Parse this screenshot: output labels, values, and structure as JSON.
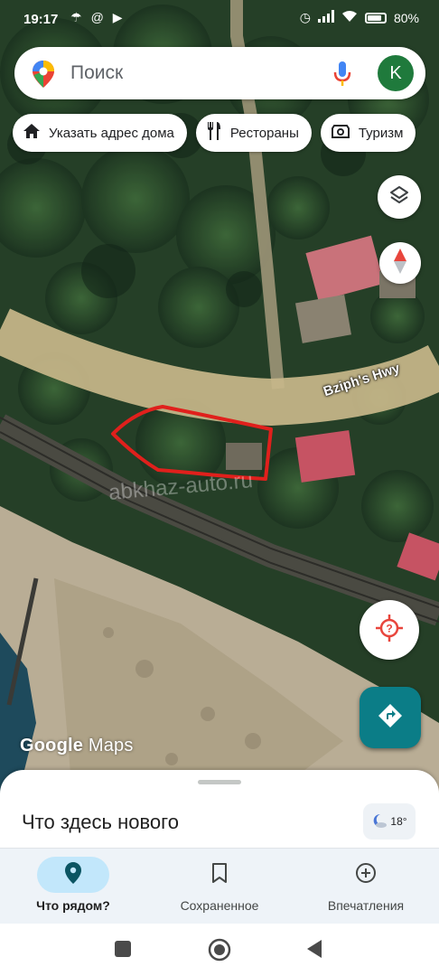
{
  "status_bar": {
    "time": "19:17",
    "battery": "80",
    "battery_level": 0.8,
    "icons": [
      "umbrella-icon",
      "threads-icon",
      "play-icon",
      "alarm-icon",
      "signal-icon",
      "wifi-icon",
      "battery-icon"
    ]
  },
  "search": {
    "placeholder": "Поиск",
    "avatar_letter": "K"
  },
  "chips": [
    {
      "label": "Указать адрес дома",
      "icon": "home-icon"
    },
    {
      "label": "Рестораны",
      "icon": "restaurant-icon"
    },
    {
      "label": "Туризм",
      "icon": "attraction-icon"
    }
  ],
  "map": {
    "road_label": "Bziph's Hwy",
    "watermark": "abkhaz-auto.ru",
    "logo_google": "Google",
    "logo_maps": "Maps"
  },
  "sheet": {
    "title": "Что здесь нового",
    "weather_temp": "18°"
  },
  "bottom_nav": [
    {
      "label": "Что рядом?",
      "icon": "location-pin-icon",
      "active": true
    },
    {
      "label": "Сохраненное",
      "icon": "bookmark-icon",
      "active": false
    },
    {
      "label": "Впечатления",
      "icon": "add-circle-icon",
      "active": false
    }
  ],
  "colors": {
    "accent": "#0b7d87",
    "location_red": "#e8453c",
    "avatar_green": "#1f7a3c",
    "active_pill": "#c2e7fb"
  }
}
